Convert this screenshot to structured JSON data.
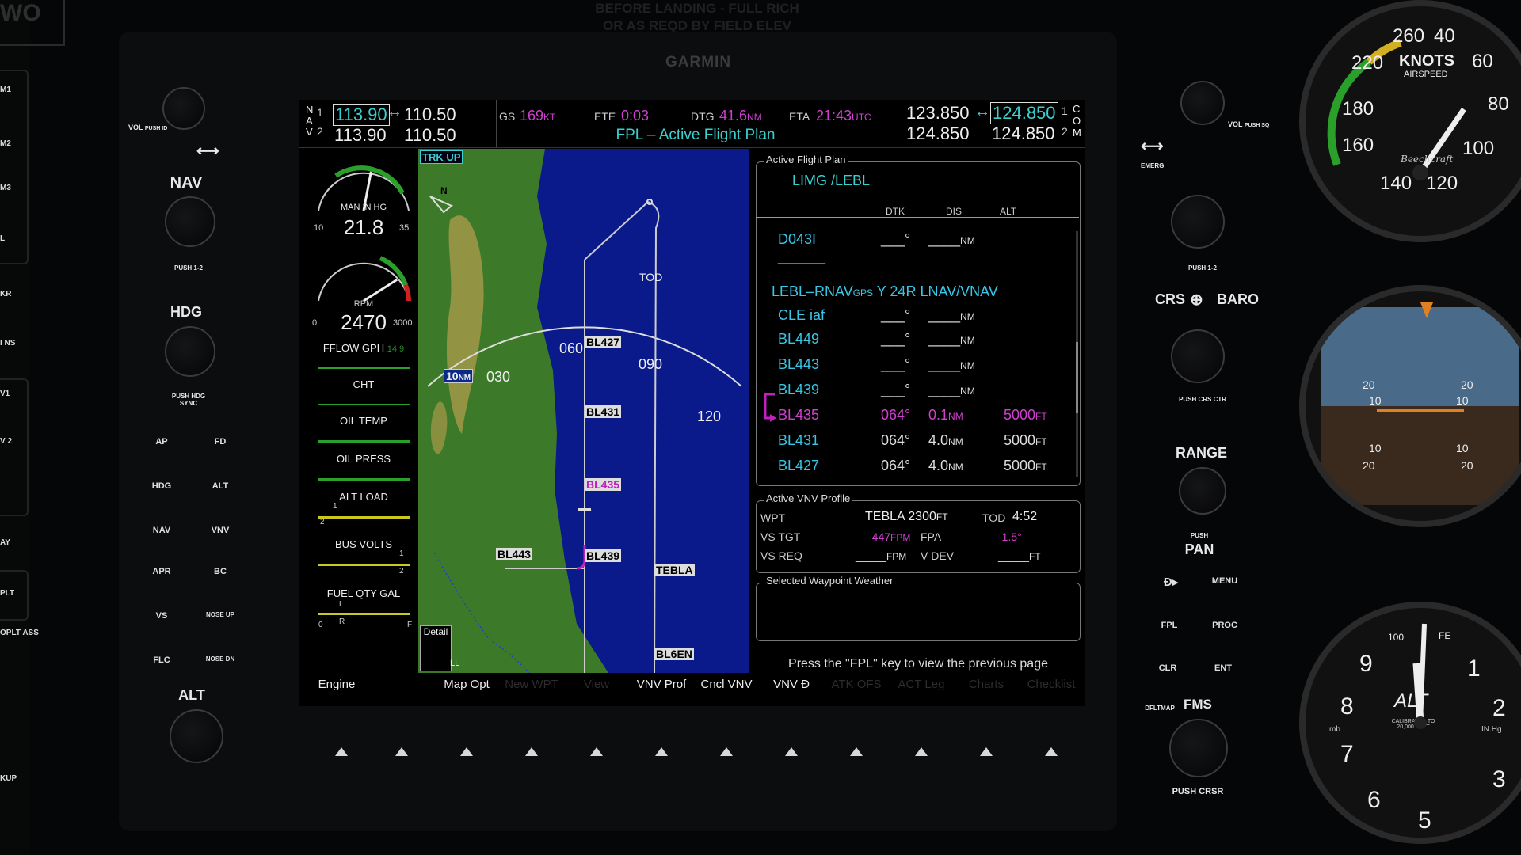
{
  "top_text": [
    "BEFORE LANDING - FULL RICH",
    "OR AS REQD BY FIELD ELEV"
  ],
  "corner_label": "WO",
  "brand": "GARMIN",
  "left_strip": [
    "M1",
    "M2",
    "M3",
    "L",
    "KR",
    "I NS",
    "V1",
    "V 2",
    "AY",
    "PLT",
    "OPLT ASS",
    "KUP"
  ],
  "left_controls": {
    "vol_label": "VOL",
    "vol_push": "PUSH ID",
    "swap_icon": "double-arrow-icon",
    "nav_label": "NAV",
    "nav_push": "PUSH 1-2",
    "hdg_label": "HDG",
    "hdg_push": "PUSH HDG SYNC",
    "ap_buttons": [
      "AP",
      "FD",
      "HDG",
      "ALT",
      "NAV",
      "VNV",
      "APR",
      "BC",
      "VS",
      "NOSE UP",
      "FLC",
      "NOSE DN"
    ],
    "alt_label": "ALT"
  },
  "right_controls": {
    "vol_label": "VOL",
    "vol_push": "PUSH SQ",
    "emerg_label": "EMERG",
    "com_push": "PUSH 1-2",
    "crs_label": "CRS",
    "baro_label": "BARO",
    "crs_push": "PUSH CRS CTR",
    "range_label": "RANGE",
    "pan_push": "PUSH",
    "pan_label": "PAN",
    "direct_icon": "direct-to-icon",
    "menu_label": "MENU",
    "fpl_label": "FPL",
    "proc_label": "PROC",
    "clr_label": "CLR",
    "ent_label": "ENT",
    "dfltmap_label": "DFLTMAP",
    "fms_label": "FMS",
    "fms_push": "PUSH CRSR"
  },
  "nav_radio": {
    "nav1_active": "113.90",
    "nav1_standby": "110.50",
    "nav2_active": "113.90",
    "nav2_standby": "110.50",
    "nav_label": "N A V",
    "nav1_num": "1",
    "nav2_num": "2"
  },
  "com_radio": {
    "com1_active": "123.850",
    "com1_standby": "124.850",
    "com2_active": "124.850",
    "com2_standby": "124.850",
    "com_label": "C O M",
    "com1_num": "1",
    "com2_num": "2"
  },
  "status": {
    "gs_label": "GS",
    "gs_value": "169",
    "gs_unit": "KT",
    "ete_label": "ETE",
    "ete_value": "0:03",
    "dtg_label": "DTG",
    "dtg_value": "41.6",
    "dtg_unit": "NM",
    "eta_label": "ETA",
    "eta_value": "21:43",
    "eta_unit": "UTC",
    "page_title": "FPL – Active Flight Plan"
  },
  "engine": {
    "man_label": "MAN IN HG",
    "man_value": "21.8",
    "man_min": "10",
    "man_max": "35",
    "rpm_label": "RPM",
    "rpm_value": "2470",
    "rpm_min": "0",
    "rpm_max": "3000",
    "fflow_label": "FFLOW GPH",
    "fflow_value": "14.9",
    "cht_label": "CHT",
    "oil_temp_label": "OIL TEMP",
    "oil_press_label": "OIL PRESS",
    "alt_load_label": "ALT LOAD",
    "bus_volts_label": "BUS VOLTS",
    "fuel_label": "FUEL QTY GAL",
    "fuel_min": "0",
    "fuel_max": "F",
    "alt_load_marker": "1",
    "alt_load_marker2": "2",
    "bus_marker1": "1",
    "bus_marker2": "2",
    "fuel_l": "L",
    "fuel_r": "R",
    "man_fraction": 0.56,
    "rpm_fraction": 0.82
  },
  "map": {
    "orientation": "TRK UP",
    "north_label": "N",
    "range": "10",
    "range_unit": "NM",
    "headings": [
      "030",
      "060",
      "090",
      "120"
    ],
    "tod": "TOD",
    "waypoints": [
      "BL427",
      "BL431",
      "BL435",
      "BL439",
      "BL443",
      "TEBLA",
      "BL6EN"
    ],
    "detail_label": "Detail",
    "detail_value": "LL"
  },
  "flight_plan": {
    "panel_title": "Active Flight Plan",
    "route": "LIMG /LEBL",
    "col_dtk": "DTK",
    "col_dis": "DIS",
    "col_alt": "ALT",
    "rows": [
      {
        "wpt": "D043I",
        "dtk": "___°",
        "dis": "____",
        "dis_unit": "NM",
        "alt": "",
        "alt_unit": "",
        "active": false
      },
      {
        "wpt": "______",
        "dtk": "",
        "dis": "",
        "dis_unit": "",
        "alt": "",
        "alt_unit": "",
        "active": false
      },
      {
        "wpt": "CLE iaf",
        "dtk": "___°",
        "dis": "____",
        "dis_unit": "NM",
        "alt": "",
        "alt_unit": "",
        "active": false
      },
      {
        "wpt": "BL449",
        "dtk": "___°",
        "dis": "____",
        "dis_unit": "NM",
        "alt": "",
        "alt_unit": "",
        "active": false
      },
      {
        "wpt": "BL443",
        "dtk": "___°",
        "dis": "____",
        "dis_unit": "NM",
        "alt": "",
        "alt_unit": "",
        "active": false
      },
      {
        "wpt": "BL439",
        "dtk": "___°",
        "dis": "____",
        "dis_unit": "NM",
        "alt": "",
        "alt_unit": "",
        "active": false
      },
      {
        "wpt": "BL435",
        "dtk": "064°",
        "dis": "0.1",
        "dis_unit": "NM",
        "alt": "5000",
        "alt_unit": "FT",
        "active": true
      },
      {
        "wpt": "BL431",
        "dtk": "064°",
        "dis": "4.0",
        "dis_unit": "NM",
        "alt": "5000",
        "alt_unit": "FT",
        "active": false
      },
      {
        "wpt": "BL427",
        "dtk": "064°",
        "dis": "4.0",
        "dis_unit": "NM",
        "alt": "5000",
        "alt_unit": "FT",
        "active": false
      }
    ],
    "procedure": "LEBL–RNAV",
    "procedure_gps": "GPS",
    "procedure_rest": " Y 24R LNAV/VNAV"
  },
  "vnv": {
    "panel_title": "Active VNV Profile",
    "wpt_label": "WPT",
    "wpt_value": "TEBLA",
    "wpt_alt": "2300",
    "wpt_alt_unit": "FT",
    "tod_label": "TOD",
    "tod_value": "4:52",
    "vstgt_label": "VS TGT",
    "vstgt_value": "-447",
    "vstgt_unit": "FPM",
    "fpa_label": "FPA",
    "fpa_value": "-1.5°",
    "vsreq_label": "VS REQ",
    "vsreq_value": "_____",
    "vsreq_unit": "FPM",
    "vdev_label": "V DEV",
    "vdev_value": "_____",
    "vdev_unit": "FT"
  },
  "weather": {
    "panel_title": "Selected Waypoint Weather"
  },
  "footer_msg": "Press the \"FPL\" key to view the previous page",
  "softkeys": [
    {
      "label": "Engine",
      "enabled": true
    },
    {
      "label": "",
      "enabled": false
    },
    {
      "label": "Map Opt",
      "enabled": true
    },
    {
      "label": "New WPT",
      "enabled": false
    },
    {
      "label": "View",
      "enabled": false
    },
    {
      "label": "VNV Prof",
      "enabled": true
    },
    {
      "label": "Cncl VNV",
      "enabled": true
    },
    {
      "label": "VNV Đ",
      "enabled": true
    },
    {
      "label": "ATK OFS",
      "enabled": false
    },
    {
      "label": "ACT Leg",
      "enabled": false
    },
    {
      "label": "Charts",
      "enabled": false
    },
    {
      "label": "Checklist",
      "enabled": false
    }
  ],
  "airspeed": {
    "marks": [
      "40",
      "60",
      "80",
      "100",
      "120",
      "140",
      "160",
      "180",
      "220",
      "260"
    ],
    "unit": "KNOTS",
    "sub": "AIRSPEED",
    "maker": "Beechcraft"
  },
  "attitude": {
    "marks": [
      "20",
      "10",
      "10",
      "20"
    ]
  },
  "altimeter": {
    "marks": [
      "1",
      "2",
      "3",
      "5",
      "6",
      "7",
      "8",
      "9"
    ],
    "label": "ALT",
    "cal": "CALIBRATED TO 20,000 FEET",
    "inhg": "IN.Hg",
    "mb": "mb",
    "hundred": "100",
    "fe": "FE"
  },
  "colors": {
    "cyan": "#39d0d0",
    "magenta": "#d040d0",
    "water": "#0a1a8a",
    "land": "#3c7a2a",
    "active_route": "#c020c0"
  }
}
